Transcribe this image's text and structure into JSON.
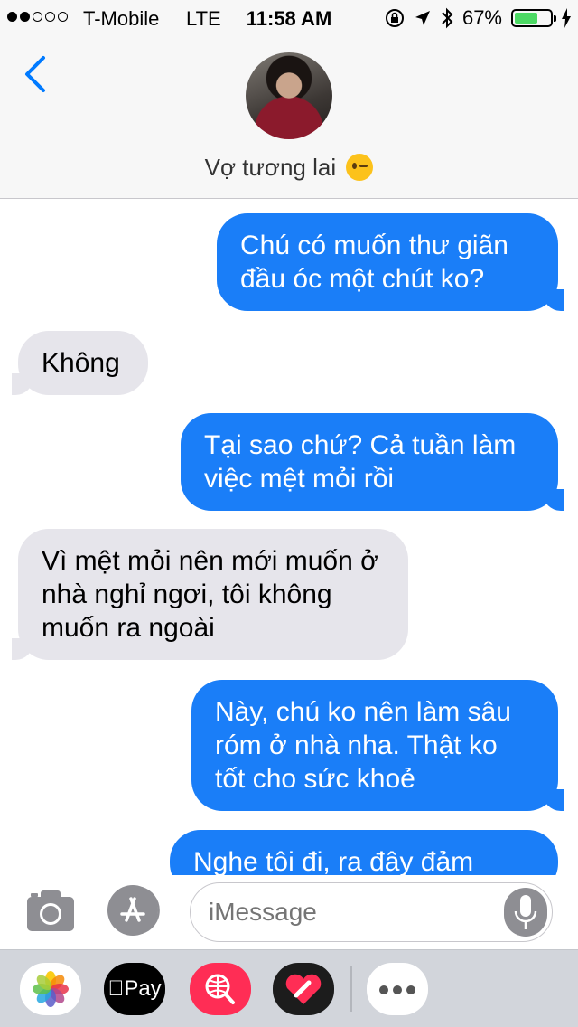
{
  "status_bar": {
    "carrier": "T-Mobile",
    "network": "LTE",
    "time": "11:58 AM",
    "battery_percent": "67%",
    "battery_level": 0.67,
    "signal_bars_filled": 2,
    "signal_bars_total": 5
  },
  "header": {
    "contact_name": "Vợ tương lai",
    "contact_emoji": "winking-face"
  },
  "messages": [
    {
      "direction": "sent",
      "text": "Chú có muốn thư giãn đầu óc một chút ko?"
    },
    {
      "direction": "received",
      "text": "Không"
    },
    {
      "direction": "sent",
      "text": "Tại sao chứ? Cả tuần làm việc mệt mỏi rồi"
    },
    {
      "direction": "received",
      "text": "Vì mệt mỏi nên mới muốn ở nhà nghỉ ngơi, tôi không muốn ra ngoài"
    },
    {
      "direction": "sent",
      "text": "Này, chú ko nên làm sâu róm ở nhà nha. Thật ko tốt cho sức khoẻ"
    },
    {
      "direction": "sent",
      "text": "Nghe tôi đi, ra đây đảm"
    }
  ],
  "input": {
    "placeholder": "iMessage"
  },
  "app_drawer": {
    "apple_pay_label": "Pay"
  },
  "colors": {
    "sent_bubble": "#1a7ef8",
    "received_bubble": "#e6e5eb",
    "accent": "#007aff",
    "battery": "#4cd964"
  }
}
